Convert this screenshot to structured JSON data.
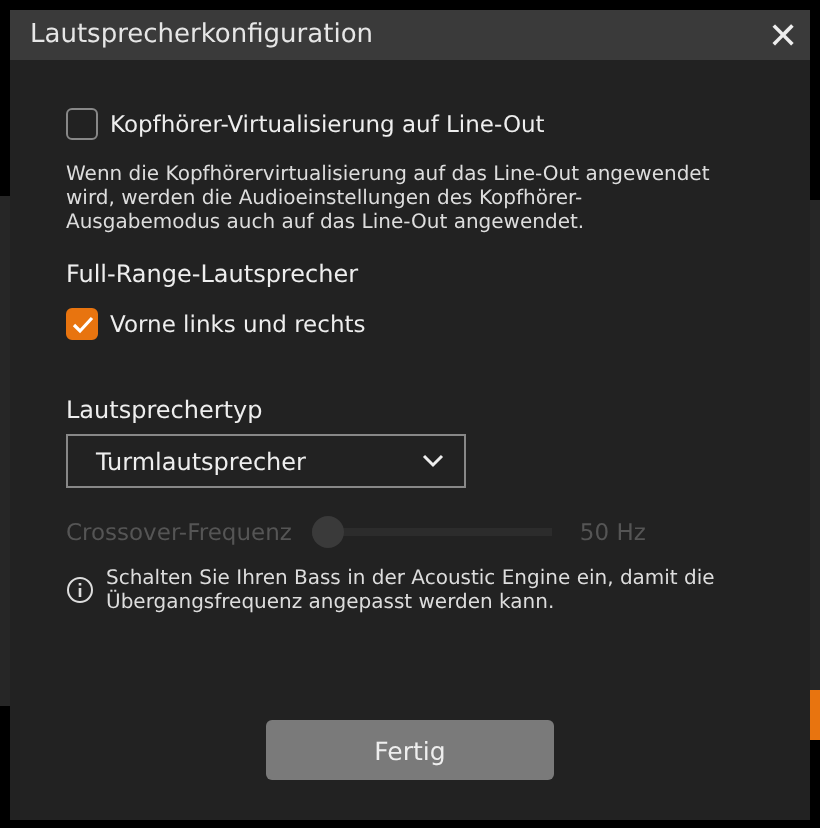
{
  "dialog": {
    "title": "Lautsprecherkonfiguration",
    "close": "✕",
    "virtualization": {
      "label": "Kopfhörer-Virtualisierung auf Line-Out",
      "checked": false
    },
    "virtualization_note": "Wenn die Kopfhörervirtualisierung auf das Line-Out angewendet wird, werden die Audioeinstellungen des Kopfhörer-Ausgabemodus auch auf das Line-Out angewendet.",
    "full_range_heading": "Full-Range-Lautsprecher",
    "full_range": {
      "label": "Vorne links und rechts",
      "checked": true
    },
    "speaker_type_label": "Lautsprechertyp",
    "speaker_type": {
      "value": "Turmlautsprecher"
    },
    "crossover": {
      "label": "Crossover-Frequenz",
      "disabled": true,
      "level": 0,
      "reading": "50 Hz"
    },
    "info": "Schalten Sie Ihren Bass in der Acoustic Engine ein, damit die Übergangsfrequenz angepasst werden kann.",
    "done_button": "Fertig"
  }
}
